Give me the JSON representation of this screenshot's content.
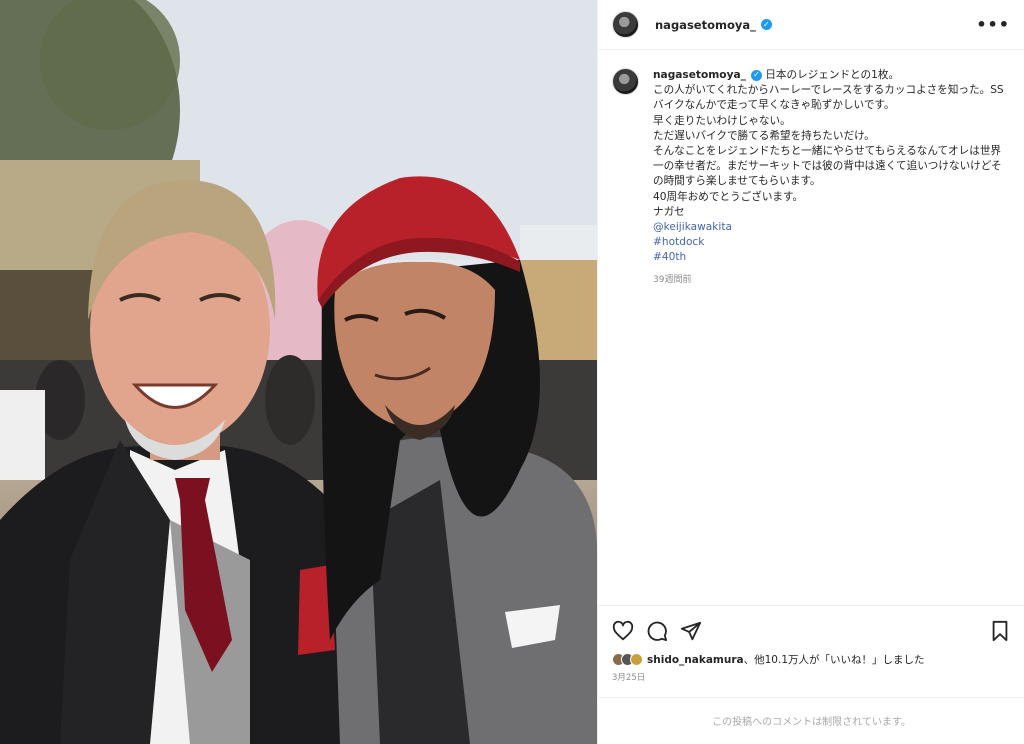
{
  "post": {
    "username": "nagasetomoya_",
    "verified_mark": "✓",
    "more_icon": "•••",
    "caption_lines": [
      "日本のレジェンドとの1枚。",
      "この人がいてくれたからハーレーでレースをするカッコよさを知った。SSバイクなんかで走って早くなきゃ恥ずかしいです。",
      "早く走りたいわけじゃない。",
      "ただ遅いバイクで勝てる希望を持ちたいだけ。",
      "そんなことをレジェンドたちと一緒にやらせてもらえるなんてオレは世界一の幸せ者だ。まだサーキットでは彼の背中は遠くて追いつけないけどその時間すら楽しませてもらいます。",
      "40周年おめでとうございます。",
      "ナガセ"
    ],
    "tags": [
      "@keijikawakita",
      "#hotdock",
      "#40th"
    ],
    "time_ago": "39週間前",
    "likes": {
      "user": "shido_nakamura",
      "rest": "、他10.1万人が「いいね！」しました"
    },
    "date": "3月25日",
    "comments_disabled": "この投稿へのコメントは制限されています。"
  },
  "icons": {
    "like": "heart-icon",
    "comment": "speech-bubble-icon",
    "share": "paper-plane-icon",
    "save": "bookmark-icon",
    "verified": "verified-badge-icon"
  },
  "colors": {
    "link": "#4466b0",
    "verified": "#1d9bf0",
    "hat": "#b8202a"
  }
}
